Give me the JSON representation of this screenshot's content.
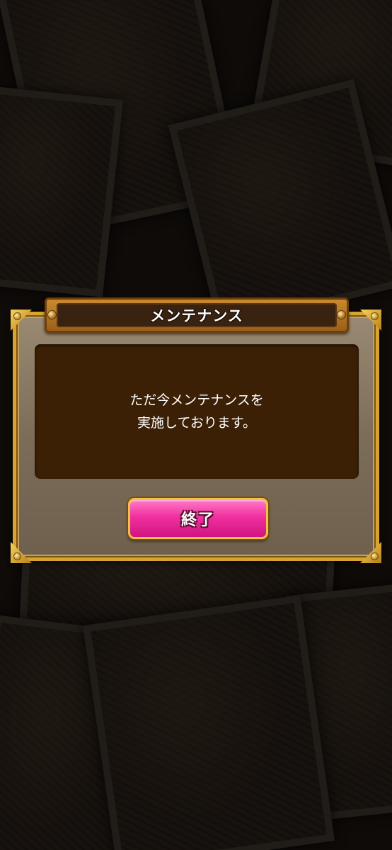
{
  "dialog": {
    "title": "メンテナンス",
    "message": "ただ今メンテナンスを\n実施しております。",
    "end_button_label": "終了"
  },
  "colors": {
    "frame_gold": "#d7a331",
    "panel_brown": "#3b2006",
    "button_pink": "#f0309f"
  }
}
